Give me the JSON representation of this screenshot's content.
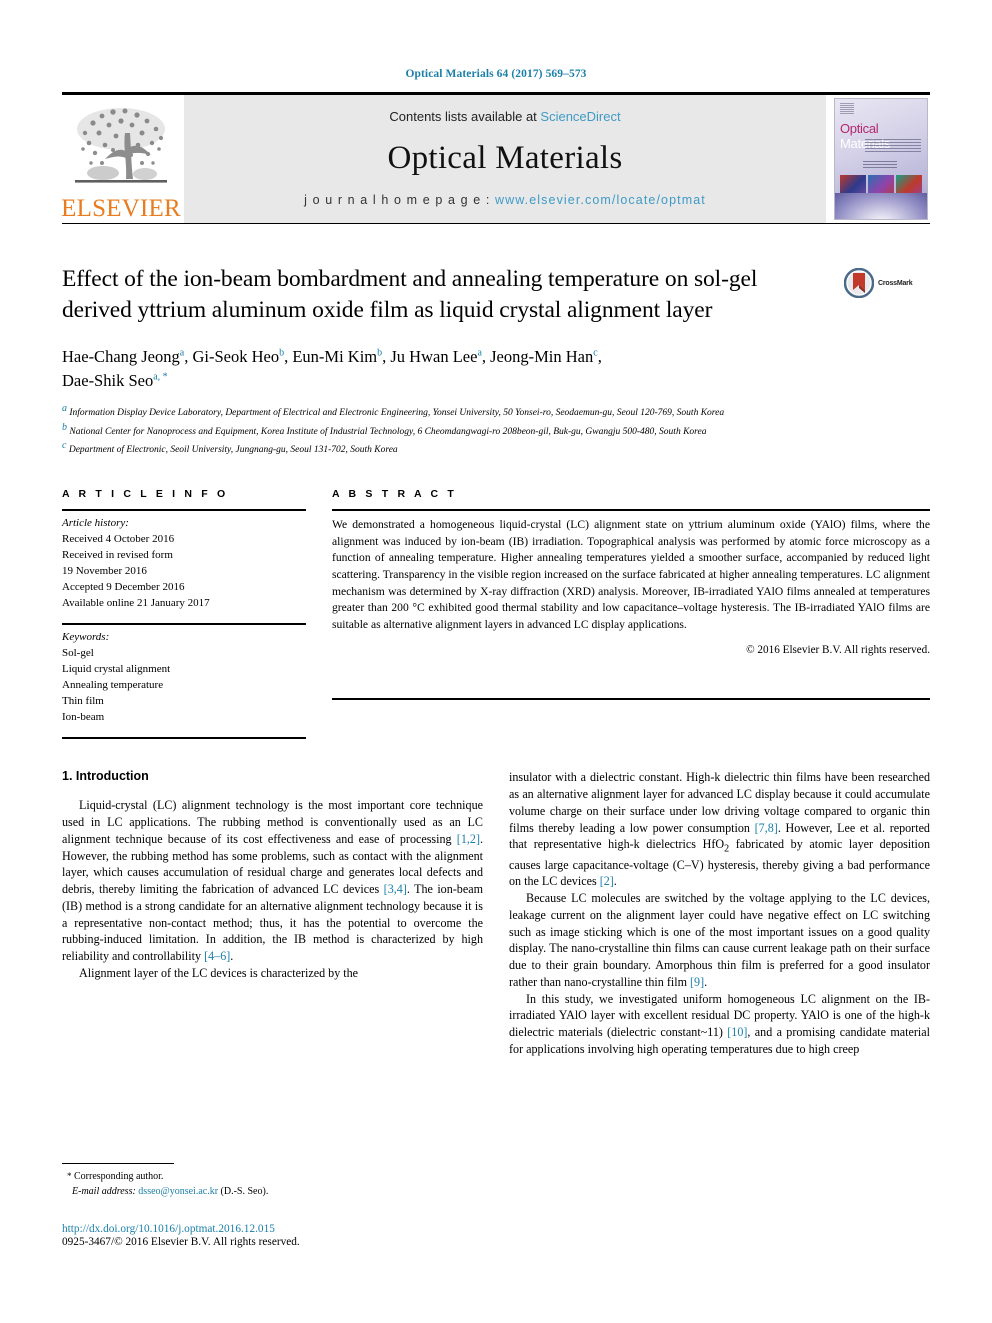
{
  "running_head": "Optical Materials 64 (2017) 569–573",
  "masthead": {
    "publisher_name": "ELSEVIER",
    "contents_prefix": "Contents lists available at ",
    "contents_link": "ScienceDirect",
    "journal_title": "Optical Materials",
    "homepage_prefix": "j o u r n a l   h o m e p a g e :  ",
    "homepage_url": "www.elsevier.com/locate/optmat",
    "cover_title_first": "Optical",
    "cover_title_second": "Materials"
  },
  "article": {
    "title": "Effect of the ion-beam bombardment and annealing temperature on sol-gel derived yttrium aluminum oxide film as liquid crystal alignment layer",
    "crossmark_label": "CrossMark",
    "authors_line1": [
      {
        "name": "Hae-Chang Jeong",
        "sup": "a"
      },
      {
        "name": "Gi-Seok Heo",
        "sup": "b"
      },
      {
        "name": "Eun-Mi Kim",
        "sup": "b"
      },
      {
        "name": "Ju Hwan Lee",
        "sup": "a"
      },
      {
        "name": "Jeong-Min Han",
        "sup": "c"
      }
    ],
    "authors_line2": [
      {
        "name": "Dae-Shik Seo",
        "sup": "a, *"
      }
    ],
    "affiliations": [
      {
        "mark": "a",
        "text": "Information Display Device Laboratory, Department of Electrical and Electronic Engineering, Yonsei University, 50 Yonsei-ro, Seodaemun-gu, Seoul 120-769, South Korea"
      },
      {
        "mark": "b",
        "text": "National Center for Nanoprocess and Equipment, Korea Institute of Industrial Technology, 6 Cheomdangwagi-ro 208beon-gil, Buk-gu, Gwangju 500-480, South Korea"
      },
      {
        "mark": "c",
        "text": "Department of Electronic, Seoil University, Jungnang-gu, Seoul 131-702, South Korea"
      }
    ]
  },
  "article_info": {
    "heading": "A R T I C L E   I N F O",
    "history_label": "Article history:",
    "history": [
      "Received 4 October 2016",
      "Received in revised form",
      "19 November 2016",
      "Accepted 9 December 2016",
      "Available online 21 January 2017"
    ],
    "keywords_label": "Keywords:",
    "keywords": [
      "Sol-gel",
      "Liquid crystal alignment",
      "Annealing temperature",
      "Thin film",
      "Ion-beam"
    ]
  },
  "abstract": {
    "heading": "A B S T R A C T",
    "text": "We demonstrated a homogeneous liquid-crystal (LC) alignment state on yttrium aluminum oxide (YAlO) films, where the alignment was induced by ion-beam (IB) irradiation. Topographical analysis was performed by atomic force microscopy as a function of annealing temperature. Higher annealing temperatures yielded a smoother surface, accompanied by reduced light scattering. Transparency in the visible region increased on the surface fabricated at higher annealing temperatures. LC alignment mechanism was determined by X-ray diffraction (XRD) analysis. Moreover, IB-irradiated YAlO films annealed at temperatures greater than 200 °C exhibited good thermal stability and low capacitance–voltage hysteresis. The IB-irradiated YAlO films are suitable as alternative alignment layers in advanced LC display applications.",
    "copyright": "© 2016 Elsevier B.V. All rights reserved."
  },
  "body": {
    "section_number_title": "1.  Introduction",
    "left_paragraphs": [
      "Liquid-crystal (LC) alignment technology is the most important core technique used in LC applications. The rubbing method is conventionally used as an LC alignment technique because of its cost effectiveness and ease of processing [1,2]. However, the rubbing method has some problems, such as contact with the alignment layer, which causes accumulation of residual charge and generates local defects and debris, thereby limiting the fabrication of advanced LC devices [3,4]. The ion-beam (IB) method is a strong candidate for an alternative alignment technology because it is a representative non-contact method; thus, it has the potential to overcome the rubbing-induced limitation. In addition, the IB method is characterized by high reliability and controllability [4–6].",
      "Alignment layer of the LC devices is characterized by the"
    ],
    "right_paragraphs": [
      "insulator with a dielectric constant. High-k dielectric thin films have been researched as an alternative alignment layer for advanced LC display because it could accumulate volume charge on their surface under low driving voltage compared to organic thin films thereby leading a low power consumption [7,8]. However, Lee et al. reported that representative high-k dielectrics HfO2 fabricated by atomic layer deposition causes large capacitance-voltage (C–V) hysteresis, thereby giving a bad performance on the LC devices [2].",
      "Because LC molecules are switched by the voltage applying to the LC devices, leakage current on the alignment layer could have negative effect on LC switching such as image sticking which is one of the most important issues on a good quality display. The nano-crystalline thin films can cause current leakage path on their surface due to their grain boundary. Amorphous thin film is preferred for a good insulator rather than nano-crystalline thin film [9].",
      "In this study, we investigated uniform homogeneous LC alignment on the IB-irradiated YAlO layer with excellent residual DC property. YAlO is one of the high-k dielectric materials (dielectric constant~11) [10], and a promising candidate material for applications involving high operating temperatures due to high creep"
    ]
  },
  "footer": {
    "corresponding_star": "*",
    "corresponding_label": "Corresponding author.",
    "email_label": "E-mail address:",
    "email": "dsseo@yonsei.ac.kr",
    "email_suffix": "(D.-S. Seo).",
    "doi": "http://dx.doi.org/10.1016/j.optmat.2016.12.015",
    "issn_line": "0925-3467/© 2016 Elsevier B.V. All rights reserved."
  },
  "colors": {
    "link_blue": "#1b7fa8",
    "sciencedirect_blue": "#3f9bc6",
    "elsevier_orange": "#E87C1E",
    "band_gray": "#e8e8e8"
  }
}
